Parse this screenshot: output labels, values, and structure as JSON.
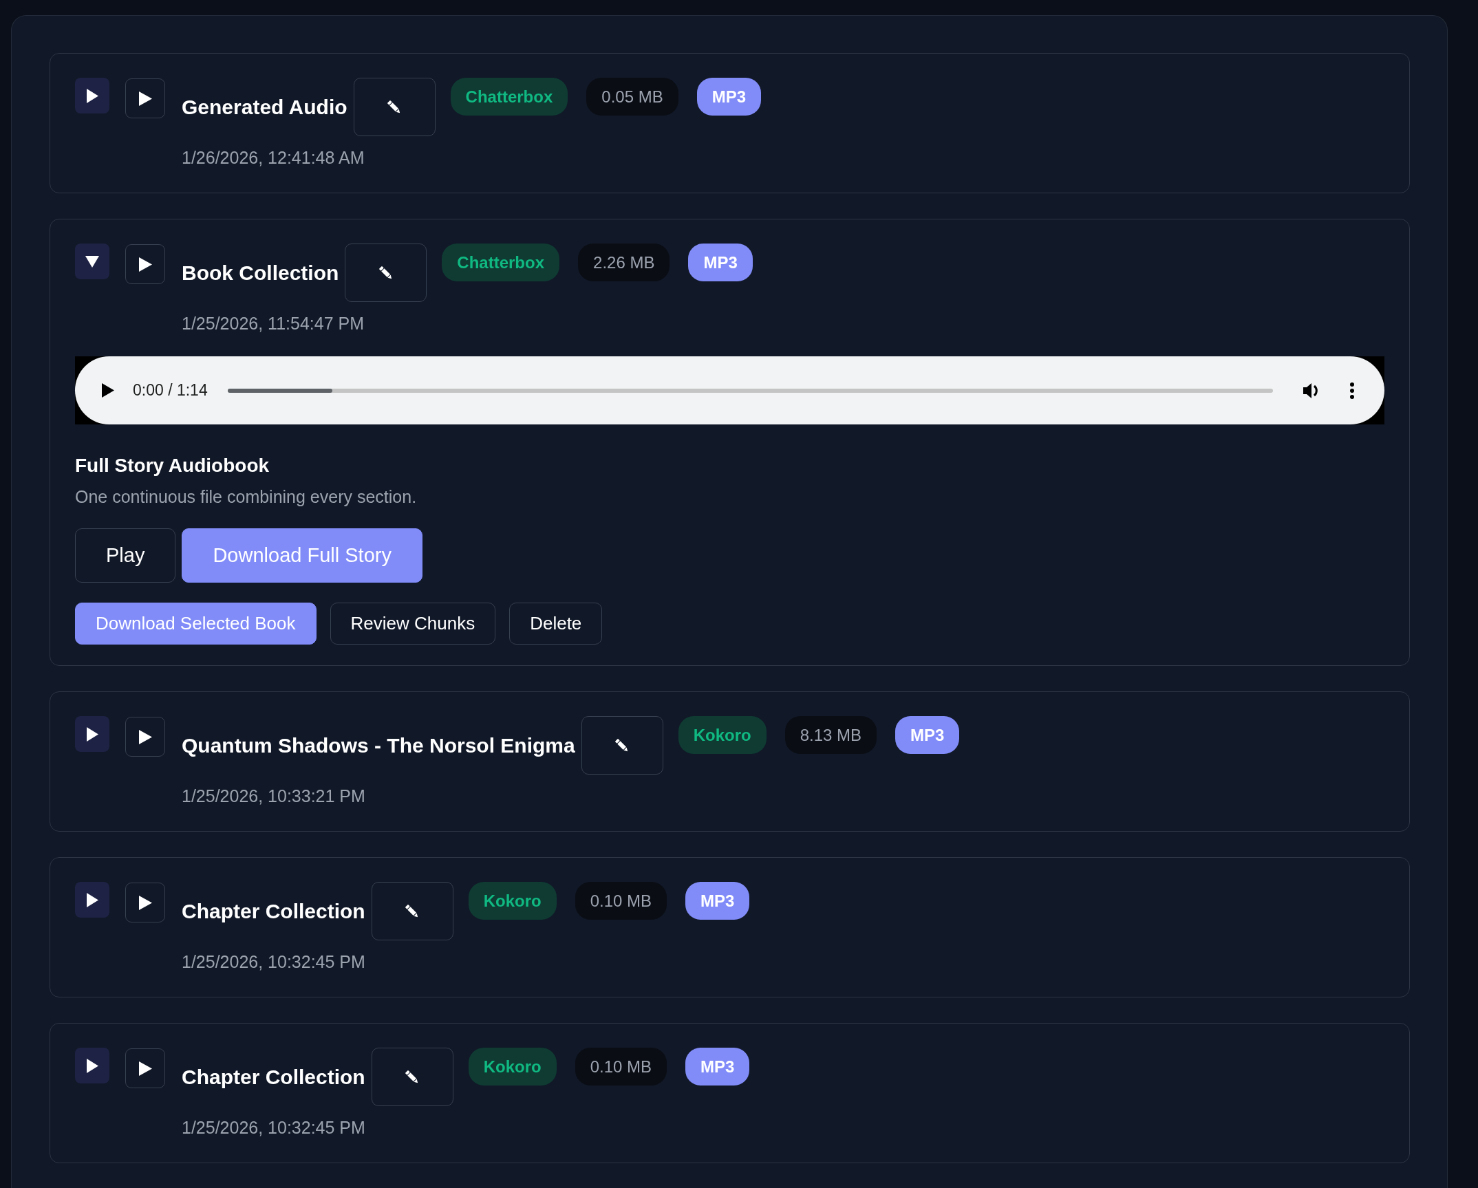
{
  "items": [
    {
      "title": "Generated Audio",
      "date": "1/26/2026, 12:41:48 AM",
      "engine": "Chatterbox",
      "size": "0.05 MB",
      "format": "MP3",
      "expanded": false
    },
    {
      "title": "Book Collection",
      "date": "1/25/2026, 11:54:47 PM",
      "engine": "Chatterbox",
      "size": "2.26 MB",
      "format": "MP3",
      "expanded": true,
      "details": {
        "player": {
          "time": "0:00 / 1:14",
          "level": 0.1
        },
        "heading": "Full Story Audiobook",
        "description": "One continuous file combining every section.",
        "story_buttons": [
          {
            "label": "Play",
            "kind": "outline"
          },
          {
            "label": "Download Full Story",
            "kind": "primary"
          }
        ],
        "actions": [
          {
            "label": "Download Selected Book",
            "kind": "primary"
          },
          {
            "label": "Review Chunks",
            "kind": "outline"
          },
          {
            "label": "Delete",
            "kind": "outline"
          }
        ]
      }
    },
    {
      "title": "Quantum Shadows - The Norsol Enigma",
      "date": "1/25/2026, 10:33:21 PM",
      "engine": "Kokoro",
      "size": "8.13 MB",
      "format": "MP3",
      "expanded": false
    },
    {
      "title": "Chapter Collection",
      "date": "1/25/2026, 10:32:45 PM",
      "engine": "Kokoro",
      "size": "0.10 MB",
      "format": "MP3",
      "expanded": false
    },
    {
      "title": "Chapter Collection",
      "date": "1/25/2026, 10:32:45 PM",
      "engine": "Kokoro",
      "size": "0.10 MB",
      "format": "MP3",
      "expanded": false
    }
  ]
}
